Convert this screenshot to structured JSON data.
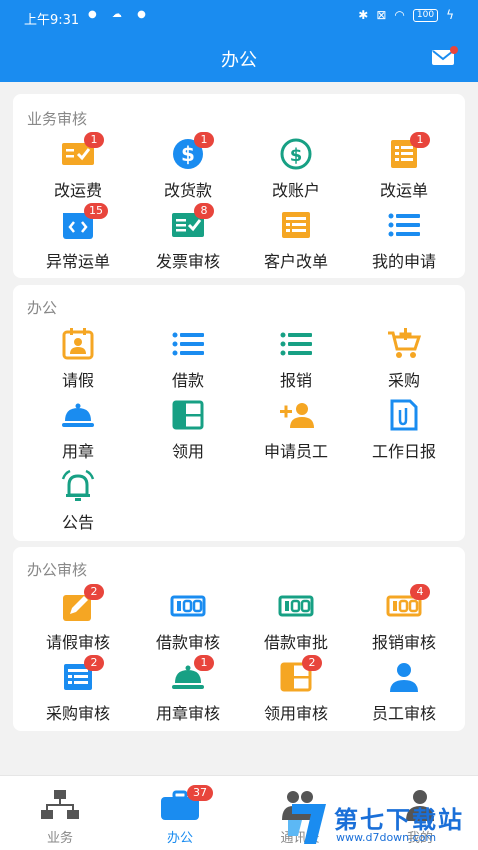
{
  "status": {
    "time": "上午9:31",
    "battery": "100"
  },
  "header": {
    "title": "办公"
  },
  "sections": [
    {
      "title": "业务审核",
      "items": [
        {
          "label": "改运费",
          "icon": "ticket-check-icon",
          "color": "#f5a623",
          "badge": "1"
        },
        {
          "label": "改货款",
          "icon": "dollar-circle-icon",
          "color": "#1a8cf0",
          "badge": "1"
        },
        {
          "label": "改账户",
          "icon": "dollar-ring-icon",
          "color": "#17a084",
          "badge": ""
        },
        {
          "label": "改运单",
          "icon": "list-doc-icon",
          "color": "#f5a623",
          "badge": "1"
        },
        {
          "label": "异常运单",
          "icon": "code-doc-icon",
          "color": "#1a8cf0",
          "badge": "15"
        },
        {
          "label": "发票审核",
          "icon": "invoice-check-icon",
          "color": "#17a084",
          "badge": "8"
        },
        {
          "label": "客户改单",
          "icon": "form-doc-icon",
          "color": "#f5a623",
          "badge": ""
        },
        {
          "label": "我的申请",
          "icon": "list-icon",
          "color": "#1a8cf0",
          "badge": ""
        }
      ]
    },
    {
      "title": "办公",
      "items": [
        {
          "label": "请假",
          "icon": "calendar-person-icon",
          "color": "#f5a623",
          "badge": ""
        },
        {
          "label": "借款",
          "icon": "list-icon",
          "color": "#1a8cf0",
          "badge": ""
        },
        {
          "label": "报销",
          "icon": "list-icon",
          "color": "#17a084",
          "badge": ""
        },
        {
          "label": "采购",
          "icon": "cart-plus-icon",
          "color": "#f5a623",
          "badge": ""
        },
        {
          "label": "用章",
          "icon": "bell-dome-icon",
          "color": "#1a8cf0",
          "badge": ""
        },
        {
          "label": "领用",
          "icon": "layout-icon",
          "color": "#17a084",
          "badge": ""
        },
        {
          "label": "申请员工",
          "icon": "add-user-icon",
          "color": "#f5a623",
          "badge": ""
        },
        {
          "label": "工作日报",
          "icon": "paperclip-doc-icon",
          "color": "#1a8cf0",
          "badge": ""
        },
        {
          "label": "公告",
          "icon": "alarm-bell-icon",
          "color": "#17a084",
          "badge": ""
        }
      ]
    },
    {
      "title": "办公审核",
      "items": [
        {
          "label": "请假审核",
          "icon": "edit-doc-icon",
          "color": "#f5a623",
          "badge": "2"
        },
        {
          "label": "借款审核",
          "icon": "money-icon",
          "color": "#1a8cf0",
          "badge": ""
        },
        {
          "label": "借款审批",
          "icon": "money-icon",
          "color": "#17a084",
          "badge": ""
        },
        {
          "label": "报销审核",
          "icon": "money-icon",
          "color": "#f5a623",
          "badge": "4"
        },
        {
          "label": "采购审核",
          "icon": "form-doc-icon",
          "color": "#1a8cf0",
          "badge": "2"
        },
        {
          "label": "用章审核",
          "icon": "bell-dome-icon",
          "color": "#17a084",
          "badge": "1"
        },
        {
          "label": "领用审核",
          "icon": "layout-icon",
          "color": "#f5a623",
          "badge": "2"
        },
        {
          "label": "员工审核",
          "icon": "user-icon",
          "color": "#1a8cf0",
          "badge": ""
        }
      ]
    }
  ],
  "tabs": [
    {
      "label": "业务",
      "icon": "org-chart-icon",
      "badge": ""
    },
    {
      "label": "办公",
      "icon": "briefcase-icon",
      "badge": "37"
    },
    {
      "label": "通讯录",
      "icon": "contacts-icon",
      "badge": ""
    },
    {
      "label": "我的",
      "icon": "profile-icon",
      "badge": ""
    }
  ],
  "watermark": {
    "title": "第七下载站",
    "url": "www.d7down.com"
  }
}
